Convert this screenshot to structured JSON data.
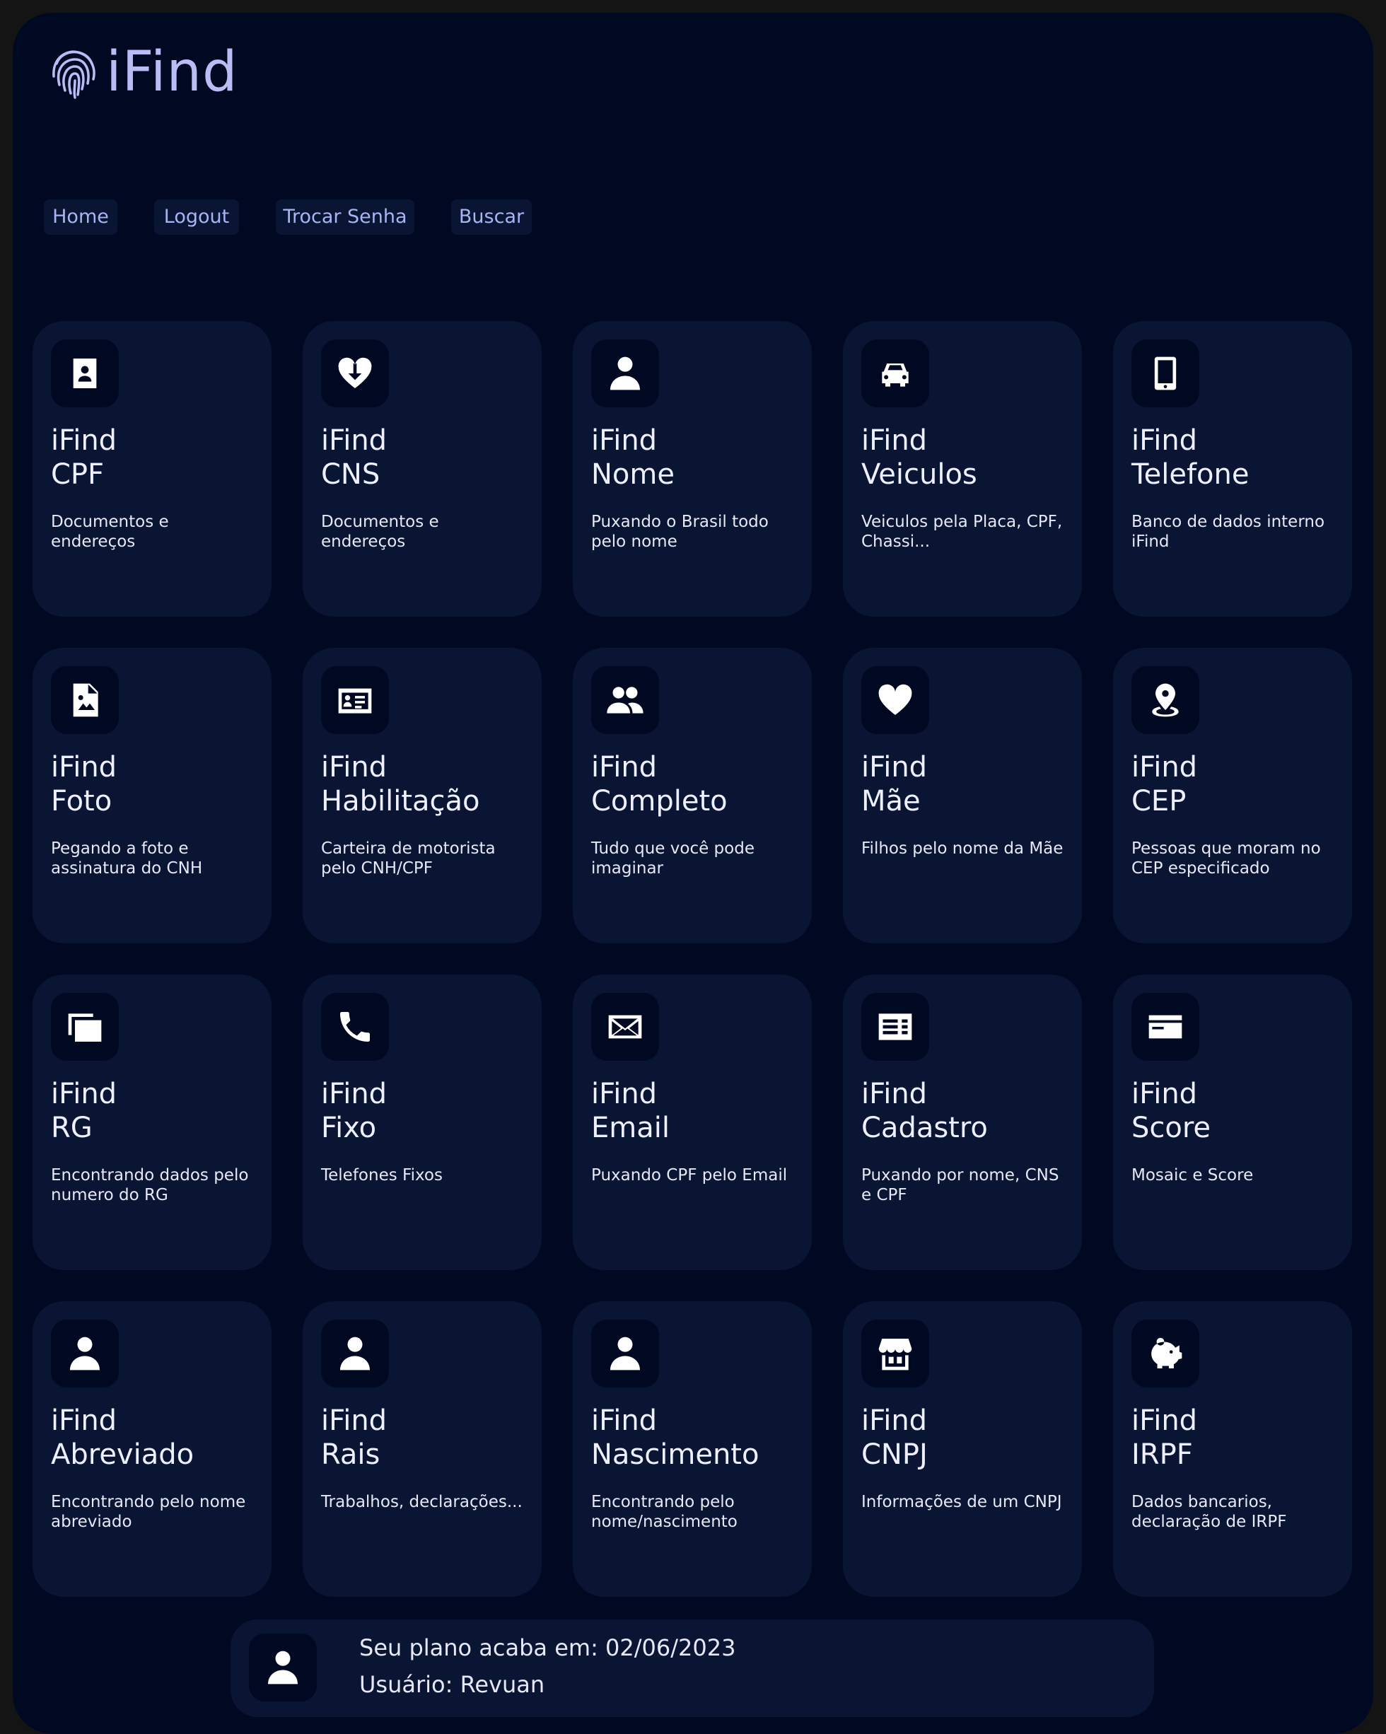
{
  "app": {
    "logo_text": "iFind",
    "logo_icon": "fingerprint-icon"
  },
  "nav": [
    {
      "label": "Home"
    },
    {
      "label": "Logout"
    },
    {
      "label": "Trocar Senha"
    },
    {
      "label": "Buscar"
    }
  ],
  "cards": [
    {
      "title": "iFind",
      "subtitle": "CPF",
      "desc": "Documentos e endereços",
      "icon": "id-card-icon"
    },
    {
      "title": "iFind",
      "subtitle": "CNS",
      "desc": "Documentos e endereços",
      "icon": "heart-arrow-icon"
    },
    {
      "title": "iFind",
      "subtitle": "Nome",
      "desc": "Puxando o Brasil todo pelo nome",
      "icon": "person-icon"
    },
    {
      "title": "iFind",
      "subtitle": "Veiculos",
      "desc": "Veiculos pela Placa, CPF, Chassi...",
      "icon": "car-icon"
    },
    {
      "title": "iFind",
      "subtitle": "Telefone",
      "desc": "Banco de dados interno iFind",
      "icon": "phone-icon"
    },
    {
      "title": "iFind",
      "subtitle": "Foto",
      "desc": "Pegando a foto e assinatura do CNH",
      "icon": "image-file-icon"
    },
    {
      "title": "iFind",
      "subtitle": "Habilitação",
      "desc": "Carteira de motorista pelo CNH/CPF",
      "icon": "license-icon"
    },
    {
      "title": "iFind",
      "subtitle": "Completo",
      "desc": "Tudo que você pode imaginar",
      "icon": "people-icon"
    },
    {
      "title": "iFind",
      "subtitle": "Mãe",
      "desc": "Filhos pelo nome da Mãe",
      "icon": "heart-icon"
    },
    {
      "title": "iFind",
      "subtitle": "CEP",
      "desc": "Pessoas que moram no CEP especificado",
      "icon": "location-pin-icon"
    },
    {
      "title": "iFind",
      "subtitle": "RG",
      "desc": "Encontrando dados pelo numero do RG",
      "icon": "cards-stack-icon"
    },
    {
      "title": "iFind",
      "subtitle": "Fixo",
      "desc": "Telefones Fixos",
      "icon": "telephone-icon"
    },
    {
      "title": "iFind",
      "subtitle": "Email",
      "desc": "Puxando CPF pelo Email",
      "icon": "envelope-icon"
    },
    {
      "title": "iFind",
      "subtitle": "Cadastro",
      "desc": "Puxando por nome, CNS e CPF",
      "icon": "form-icon"
    },
    {
      "title": "iFind",
      "subtitle": "Score",
      "desc": "Mosaic e Score",
      "icon": "credit-card-icon"
    },
    {
      "title": "iFind",
      "subtitle": "Abreviado",
      "desc": "Encontrando pelo nome abreviado",
      "icon": "person-icon"
    },
    {
      "title": "iFind",
      "subtitle": "Rais",
      "desc": "Trabalhos, declarações...",
      "icon": "person-icon"
    },
    {
      "title": "iFind",
      "subtitle": "Nascimento",
      "desc": "Encontrando pelo nome/nascimento",
      "icon": "person-icon"
    },
    {
      "title": "iFind",
      "subtitle": "CNPJ",
      "desc": "Informações de um CNPJ",
      "icon": "store-icon"
    },
    {
      "title": "iFind",
      "subtitle": "IRPF",
      "desc": "Dados bancarios, declaração de IRPF",
      "icon": "piggy-bank-icon"
    }
  ],
  "footer": {
    "plan_text": "Seu plano acaba em: 02/06/2023",
    "user_text": "Usuário: Revuan",
    "icon": "person-icon"
  }
}
